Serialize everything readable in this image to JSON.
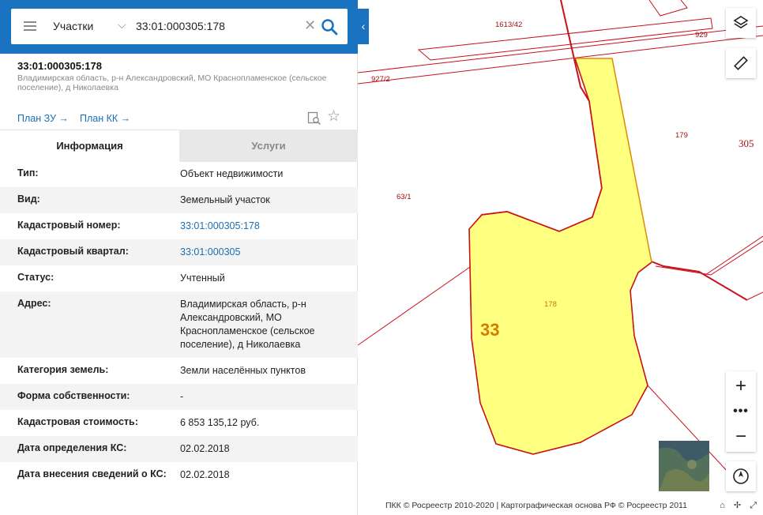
{
  "search": {
    "type_label": "Участки",
    "value": "33:01:000305:178"
  },
  "object": {
    "title": "33:01:000305:178",
    "address": "Владимирская область, р-н Александровский, МО Краснопламенское (сельское поселение), д Николаевка",
    "plan_zu": "План ЗУ →",
    "plan_kk": "План КК →"
  },
  "tabs": {
    "info": "Информация",
    "services": "Услуги"
  },
  "rows": [
    {
      "key": "Тип:",
      "value": "Объект недвижимости"
    },
    {
      "key": "Вид:",
      "value": "Земельный участок"
    },
    {
      "key": "Кадастровый номер:",
      "value": "33:01:000305:178"
    },
    {
      "key": "Кадастровый квартал:",
      "value": "33:01:000305"
    },
    {
      "key": "Статус:",
      "value": "Учтенный"
    },
    {
      "key": "Адрес:",
      "value": "Владимирская область, р-н Александровский, МО Краснопламенское (сельское поселение), д Николаевка"
    },
    {
      "key": "Категория земель:",
      "value": "Земли населённых пунктов"
    },
    {
      "key": "Форма собственности:",
      "value": "-"
    },
    {
      "key": "Кадастровая стоимость:",
      "value": "6 853 135,12 руб."
    },
    {
      "key": "Дата определения КС:",
      "value": "02.02.2018"
    },
    {
      "key": "Дата внесения сведений о КС:",
      "value": "02.02.2018"
    }
  ],
  "map": {
    "labels": {
      "l1613": "1613/42",
      "l929": "929",
      "l927": "927/2",
      "l179": "179",
      "l305": "305",
      "l63": "63/1",
      "l178": "178",
      "l33": "33"
    },
    "attribution": "ПКК © Росреестр 2010-2020 | Картографическая основа РФ © Росреестр 2011",
    "colors": {
      "boundary": "#c8101e",
      "parcel_fill": "#ffff80",
      "parcel_stroke": "#e08a00",
      "accent": "#1a73c0"
    }
  }
}
